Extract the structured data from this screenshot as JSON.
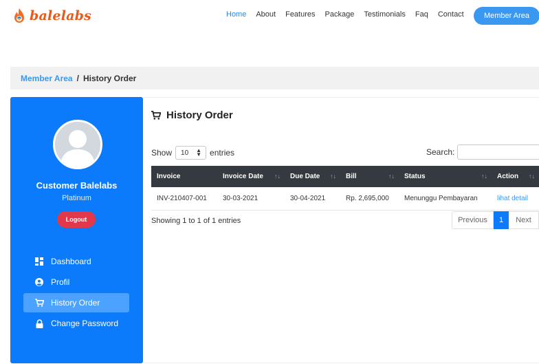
{
  "brand": {
    "name": "balelabs"
  },
  "nav": {
    "items": [
      {
        "label": "Home"
      },
      {
        "label": "About"
      },
      {
        "label": "Features"
      },
      {
        "label": "Package"
      },
      {
        "label": "Testimonials"
      },
      {
        "label": "Faq"
      },
      {
        "label": "Contact"
      }
    ],
    "cta_label": "Member Area"
  },
  "breadcrumb": {
    "parent": "Member Area",
    "separator": "/",
    "current": "History Order"
  },
  "profile": {
    "name": "Customer Balelabs",
    "level": "Platinum",
    "logout_label": "Logout"
  },
  "sidebar": {
    "items": [
      {
        "label": "Dashboard",
        "icon": "dashboard-icon"
      },
      {
        "label": "Profil",
        "icon": "user-circle-icon"
      },
      {
        "label": "History Order",
        "icon": "cart-icon",
        "active": true
      },
      {
        "label": "Change Password",
        "icon": "lock-icon"
      }
    ]
  },
  "main": {
    "title": "History Order",
    "show_label": "Show",
    "entries_value": "10",
    "entries_label": "entries",
    "search_label": "Search:",
    "search_value": "",
    "columns": [
      "Invoice",
      "Invoice Date",
      "Due Date",
      "Bill",
      "Status",
      "Action"
    ],
    "rows": [
      {
        "invoice": "INV-210407-001",
        "invoice_date": "30-03-2021",
        "due_date": "30-04-2021",
        "bill": "Rp. 2,695,000",
        "status": "Menunggu Pembayaran",
        "action": "lihat detail"
      }
    ],
    "info": "Showing 1 to 1 of 1 entries",
    "pagination": {
      "previous": "Previous",
      "current": "1",
      "next": "Next"
    }
  },
  "colors": {
    "primary": "#0b7bfb",
    "accent": "#3a98f0",
    "danger": "#e2384c",
    "table_header": "#343a40",
    "brand": "#e85a1c"
  }
}
